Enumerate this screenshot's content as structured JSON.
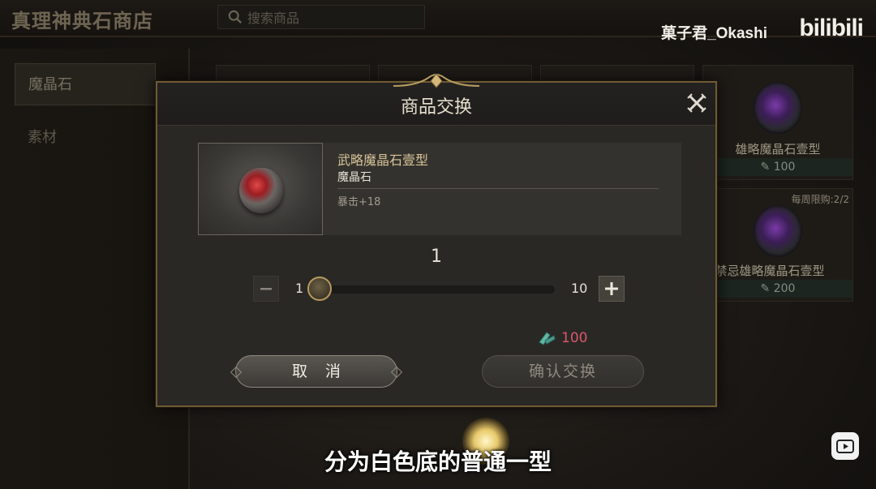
{
  "shop": {
    "title": "真理神典石商店",
    "search_placeholder": "搜索商品"
  },
  "left_nav": {
    "items": [
      {
        "label": "魔晶石",
        "active": true
      },
      {
        "label": "素材",
        "active": false
      }
    ]
  },
  "background_items": [
    {
      "name": "雄略魔晶石壹型",
      "price": "100"
    },
    {
      "name": "禁忌雄略魔晶石壹型",
      "price": "200",
      "limit": "每周限购:2/2"
    }
  ],
  "dialog": {
    "title": "商品交换",
    "item": {
      "name": "武略魔晶石壹型",
      "type": "魔晶石",
      "stat": "暴击+18"
    },
    "quantity": {
      "current": "1",
      "min": "1",
      "max": "10",
      "slider_value": 1
    },
    "cost": "100",
    "cancel_label": "取 消",
    "confirm_label": "确认交换"
  },
  "overlay": {
    "uploader": "菓子君_Okashi",
    "platform": "bilibili",
    "subtitle": "分为白色底的普通一型"
  },
  "colors": {
    "accent_gold": "#b89b5f",
    "cost_red": "#d9586a",
    "currency_teal": "#5fb8a6"
  },
  "icons": [
    "search-icon",
    "close-icon",
    "minus-icon",
    "plus-icon",
    "currency-icon",
    "play-icon"
  ]
}
